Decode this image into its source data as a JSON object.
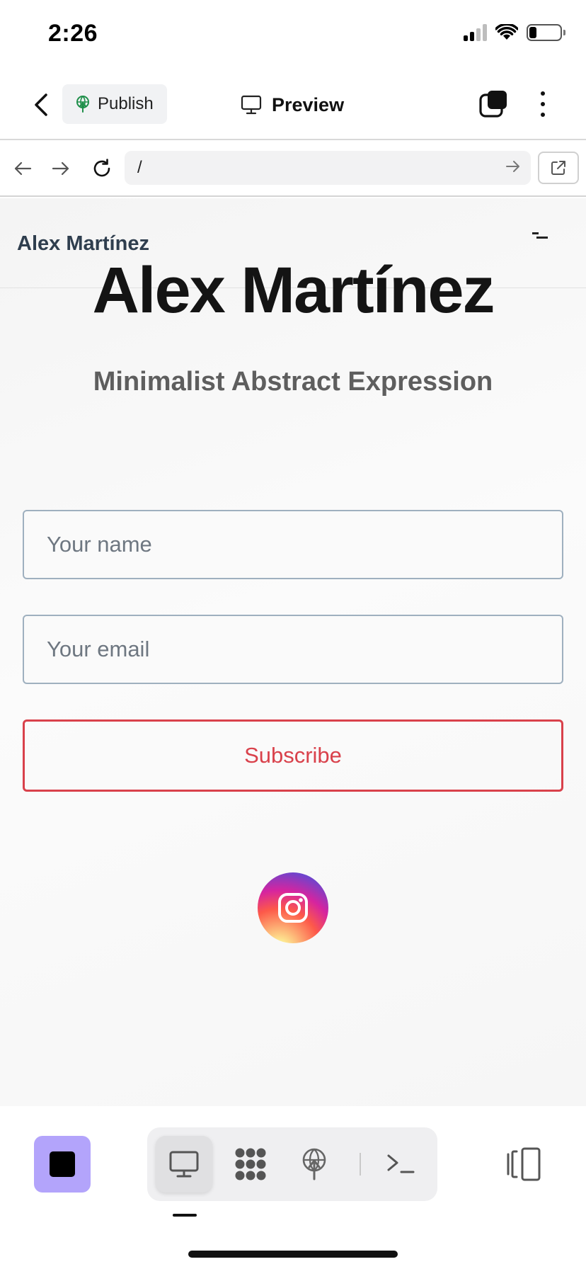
{
  "status_bar": {
    "time": "2:26"
  },
  "app_bar": {
    "publish_label": "Publish",
    "preview_label": "Preview"
  },
  "browser": {
    "url": "/"
  },
  "site": {
    "brand": "Alex Martínez",
    "hero_title": "Alex Martínez",
    "hero_subtitle": "Minimalist Abstract Expression",
    "form": {
      "name_placeholder": "Your name",
      "email_placeholder": "Your email",
      "subscribe_label": "Subscribe"
    },
    "social": {
      "icon": "instagram-icon"
    }
  },
  "colors": {
    "accent_stop": "#b3a4fb",
    "subscribe": "#d9414b",
    "publish_icon": "#1f8f4a"
  },
  "bottom_toolbar": {
    "tools": [
      "monitor-icon",
      "nodes-icon",
      "publish-globe-icon",
      "terminal-icon"
    ],
    "active_tool": "monitor-icon"
  }
}
